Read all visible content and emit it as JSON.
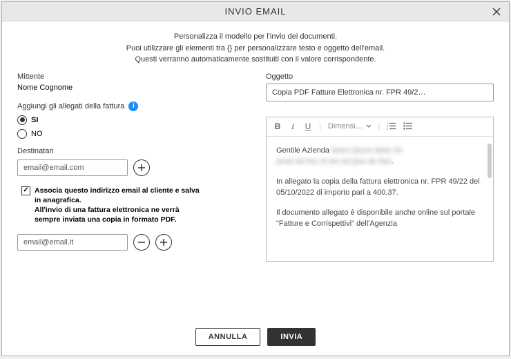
{
  "title": "INVIO EMAIL",
  "intro": {
    "line1": "Personalizza il modello per l'invio dei documenti.",
    "line2": "Puoi utilizzare gli elementi tra {} per personalizzare testo e oggetto dell'email.",
    "line3": "Questi verranno automaticamente sostituiti con il valore corrispondente."
  },
  "left": {
    "sender_label": "Mittente",
    "sender_name": "Nome Cognome",
    "attach_label": "Aggiungi gli allegati della fattura",
    "radio_yes": "SI",
    "radio_no": "NO",
    "attach_selected": "SI",
    "dest_label": "Destinatari",
    "dest1": "email@email.com",
    "assoc_text": "Associa questo indirizzo email al cliente e salva in anagrafica.\nAll'invio di una fattura elettronica ne verrà sempre inviata una copia in formato PDF.",
    "assoc_checked": true,
    "dest2": "email@email.it"
  },
  "right": {
    "subject_label": "Oggetto",
    "subject_value": "Copia PDF Fatture Elettronica nr. FPR 49/2…",
    "size_label": "Dimensi…",
    "body": {
      "greeting": "Gentile Azienda ",
      "greeting_blur": "lorem ipsum dolor sit",
      "line2_blur": "amet ad hoc re em ed ipso de fact",
      "p2": "In allegato la copia della fattura elettronica nr. FPR 49/22 del 05/10/2022 di importo pari a 400,37.",
      "p3": "Il documento allegato è disponibile anche online sul portale \"Fatture e Corrispettivi\" dell'Agenzia"
    }
  },
  "footer": {
    "cancel": "ANNULLA",
    "send": "INVIA"
  }
}
